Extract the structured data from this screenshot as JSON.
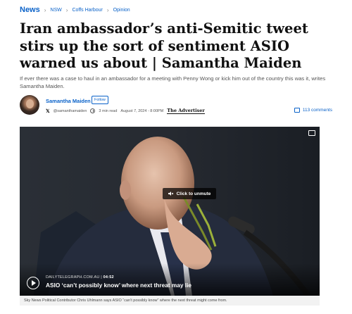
{
  "breadcrumb": {
    "section": "News",
    "items": [
      "NSW",
      "Coffs Harbour",
      "Opinion"
    ]
  },
  "article": {
    "headline": "Iran ambassador’s anti-Semitic tweet stirs up the sort of sentiment ASIO warned us about | Samantha Maiden",
    "standfirst": "If ever there was a case to haul in an ambassador for a meeting with Penny Wong or kick him out of the country this was it, writes Samantha Maiden."
  },
  "byline": {
    "author": "Samantha Maiden",
    "follow_label": "Follow",
    "handle": "@samanthamaiden",
    "read_time": "3 min read",
    "date": "August 7, 2024 - 8:00PM",
    "publication": "The Advertiser",
    "comments": "113 comments"
  },
  "video": {
    "unmute_label": "Click to unmute",
    "source": "DAILYTELEGRAPH.COM.AU",
    "separator": "|",
    "duration": "04:52",
    "title": "ASIO ‘can’t possibly know’ where next threat may lie",
    "caption": "Sky News Political Contributor Chris Uhlmann says ASIO “can’t possibly know” where the next threat might come from."
  },
  "colors": {
    "link": "#0a62c9"
  }
}
